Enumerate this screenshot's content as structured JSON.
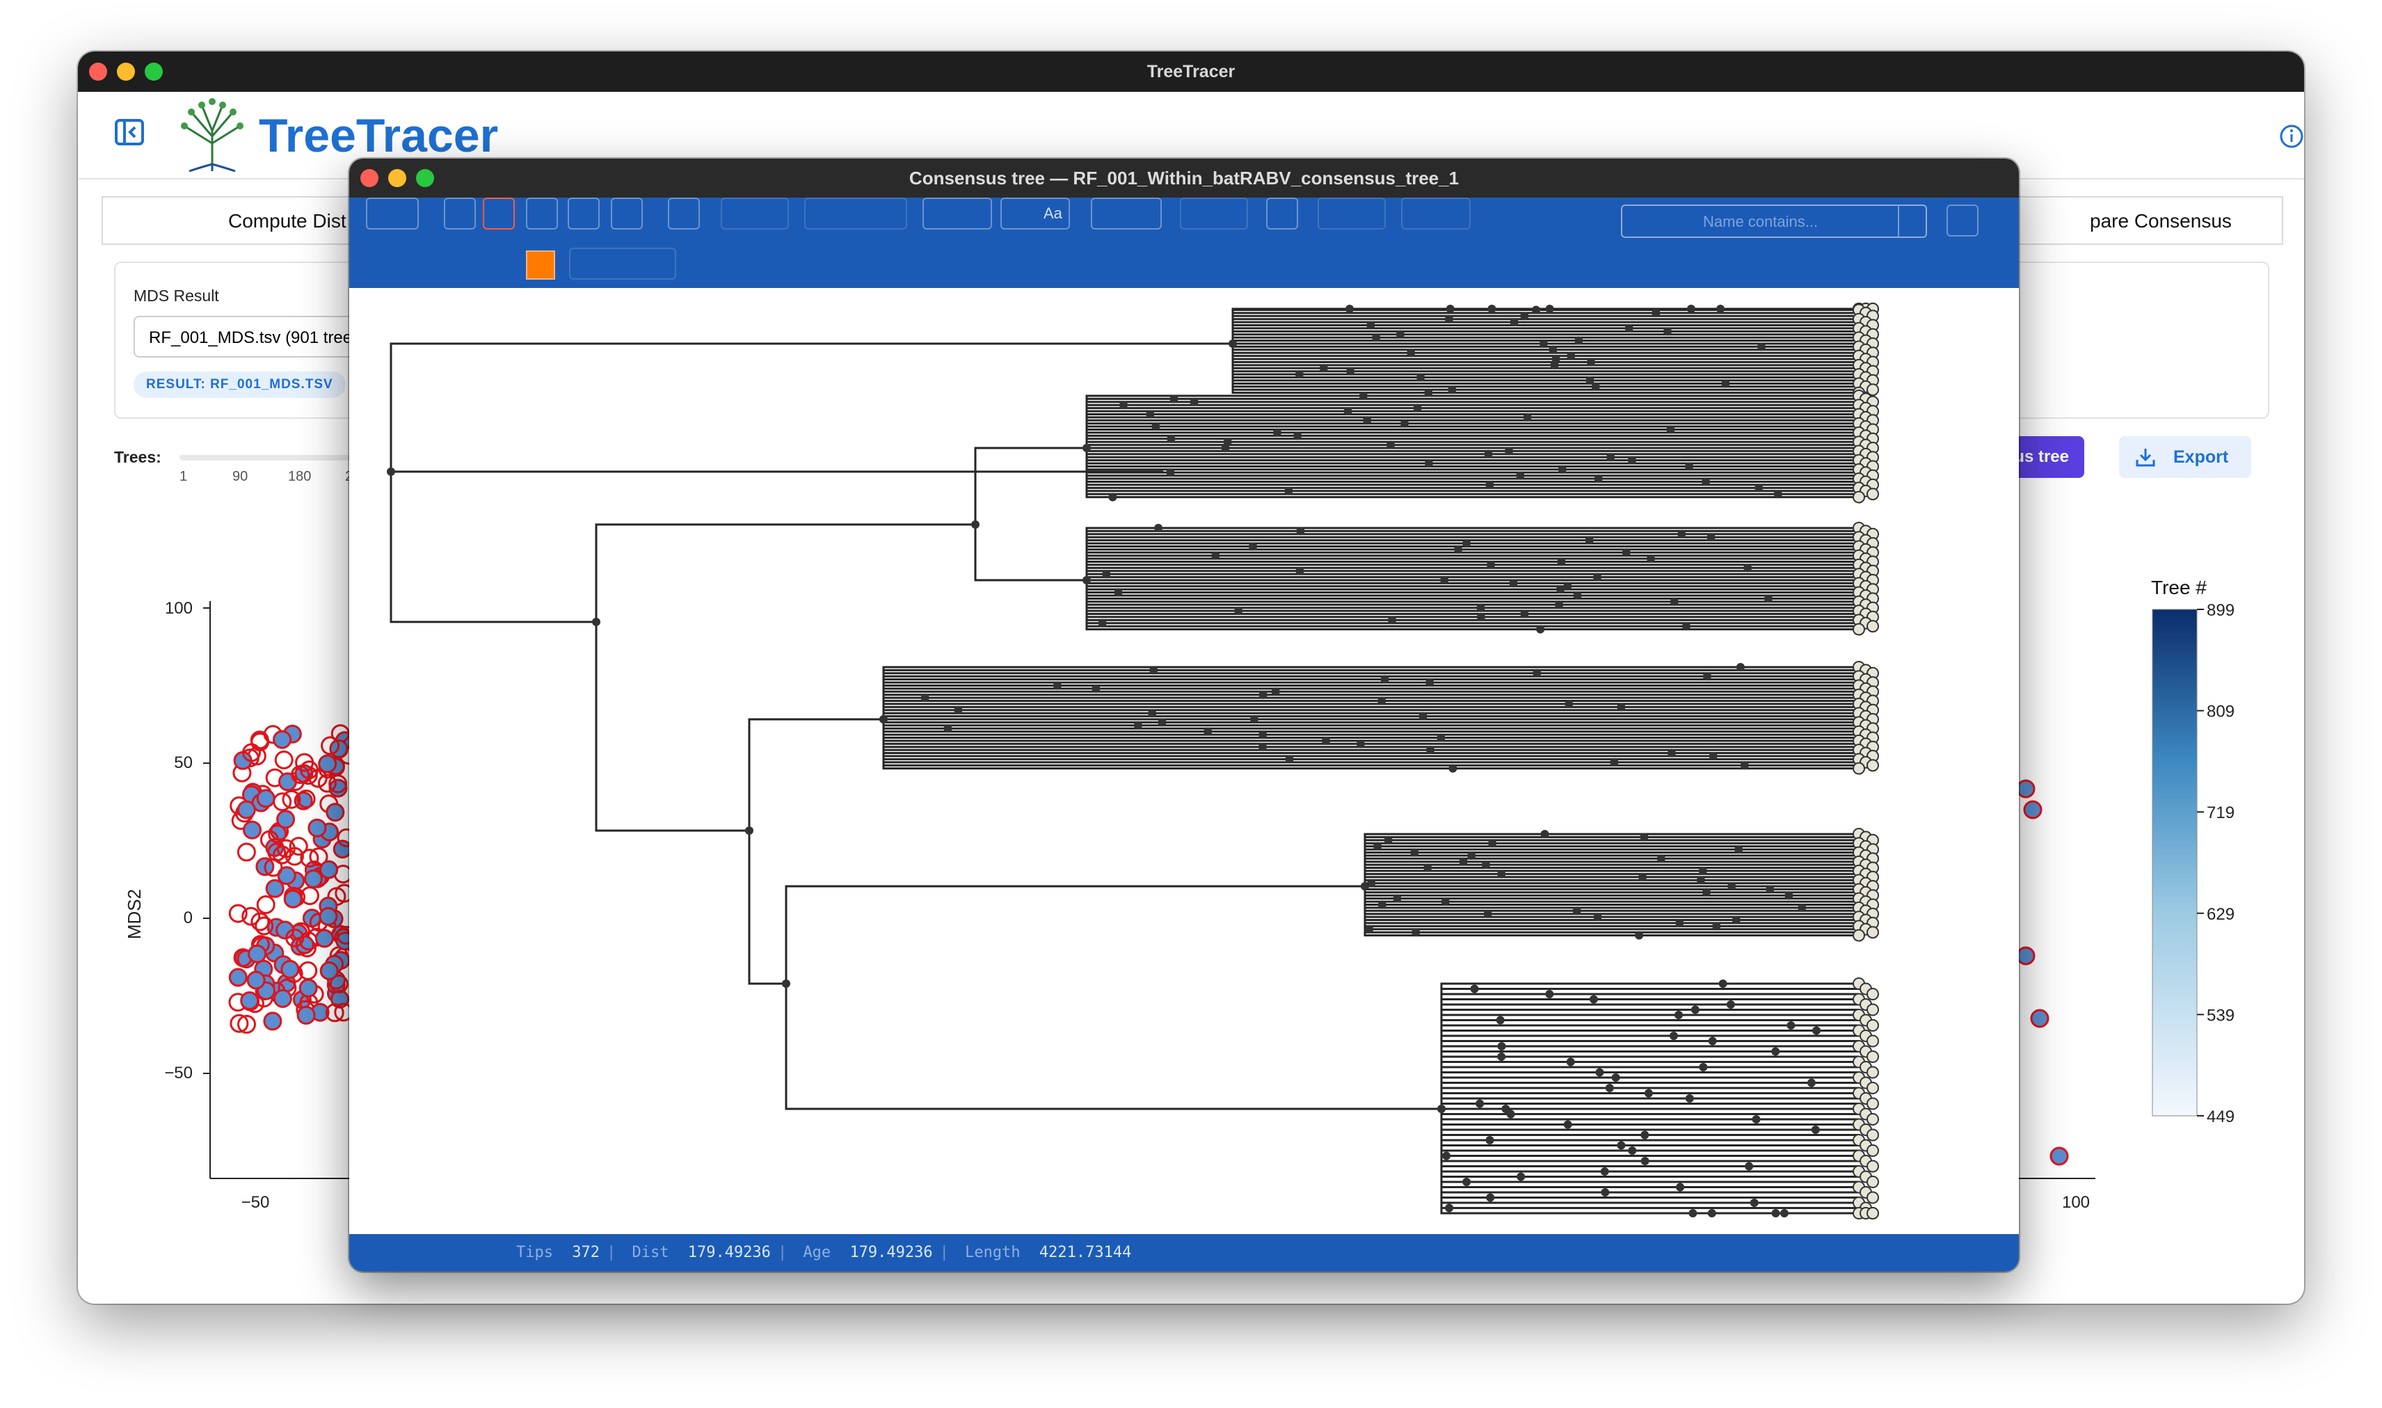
{
  "main_window": {
    "title": "TreeTracer",
    "brand": "TreeTracer",
    "tabs": {
      "compute": "Compute Dist",
      "compare": "pare Consensus"
    },
    "mds": {
      "label": "MDS Result",
      "selected": "RF_001_MDS.tsv (901 tree",
      "result_pill": "RESULT: RF_001_MDS.TSV"
    },
    "trees_slider": {
      "label": "Trees:",
      "ticks": [
        "1",
        "90",
        "180",
        "2"
      ]
    },
    "buttons": {
      "consensus": "us tree",
      "export": "Export"
    },
    "colors": {
      "brand": "#1f6fd1",
      "accent_button": "#5b3ee0",
      "point_outline": "#e0141a"
    }
  },
  "chart_data": {
    "type": "scatter",
    "ylabel": "MDS2",
    "y_ticks": [
      "100",
      "50",
      "0",
      "−50"
    ],
    "x_ticks": [
      "−50",
      "100"
    ],
    "colorbar": {
      "title": "Tree #",
      "ticks": [
        "899",
        "809",
        "719",
        "629",
        "539",
        "449"
      ],
      "range": [
        449,
        899
      ],
      "colormap": "Blues"
    }
  },
  "tree_window": {
    "title": "Consensus tree — RF_001_Within_batRABV_consensus_tree_1",
    "search_placeholder": "Name contains...",
    "toolbar_text": {
      "aa": "Aa"
    },
    "status": {
      "tips_label": "Tips",
      "tips": "372",
      "dist_label": "Dist",
      "dist": "179.49236",
      "age_label": "Age",
      "age": "179.49236",
      "length_label": "Length",
      "length": "4221.73144"
    },
    "colors": {
      "toolbar": "#1c5bb5",
      "active_swatch": "#ff7a00"
    }
  }
}
